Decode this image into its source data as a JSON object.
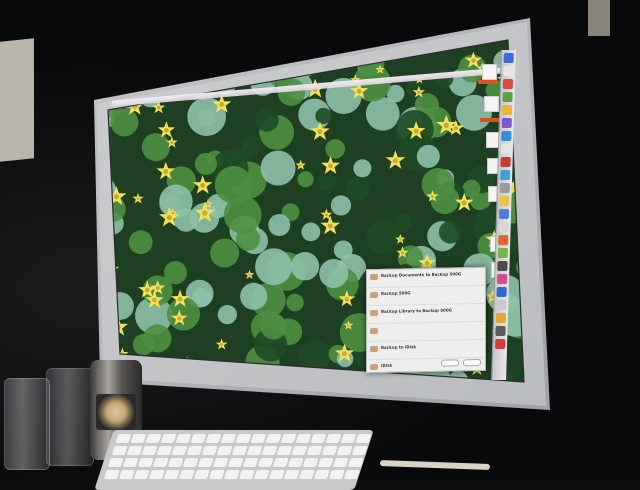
{
  "scene": {
    "subject": "desktop monitor showing flower wallpaper",
    "colors": {
      "wallpaper_leaf": "#4e8f43",
      "wallpaper_leaf_dark": "#1f4a25",
      "wallpaper_leaf_pale": "#8fc0a8",
      "flower": "#f1e25a",
      "flower_center": "#c9a836",
      "bezel": "#c9cbcd",
      "room": "#0b0d0e"
    }
  },
  "dialog": {
    "rows": [
      {
        "title": "Backup Documents to Backup 500G",
        "subtitle": ""
      },
      {
        "title": "Backup 500G",
        "subtitle": ""
      },
      {
        "title": "Backup Library to Backup 500G",
        "subtitle": ""
      },
      {
        "title": "",
        "subtitle": ""
      },
      {
        "title": "Backup to iDisk",
        "subtitle": ""
      },
      {
        "title": "iDisk",
        "subtitle": ""
      }
    ]
  },
  "dock": {
    "icon_colors": [
      "#3b6bd6",
      "#e6e6e6",
      "#d94b3b",
      "#5a9e45",
      "#e8b43a",
      "#7d5ac8",
      "#2f8fd8",
      "#e3e3e3",
      "#c43d2d",
      "#3ca3d6",
      "#9b9b9b",
      "#e8c34a",
      "#4f7fd9",
      "#d5d5d5",
      "#e0672d",
      "#6fb84a",
      "#4b4b4b",
      "#d44b8a",
      "#2d6bd4",
      "#c9c9c9",
      "#e0a63a",
      "#5b5b5b",
      "#d63b3b"
    ]
  },
  "can": {
    "brand_color": "#c4a574"
  }
}
